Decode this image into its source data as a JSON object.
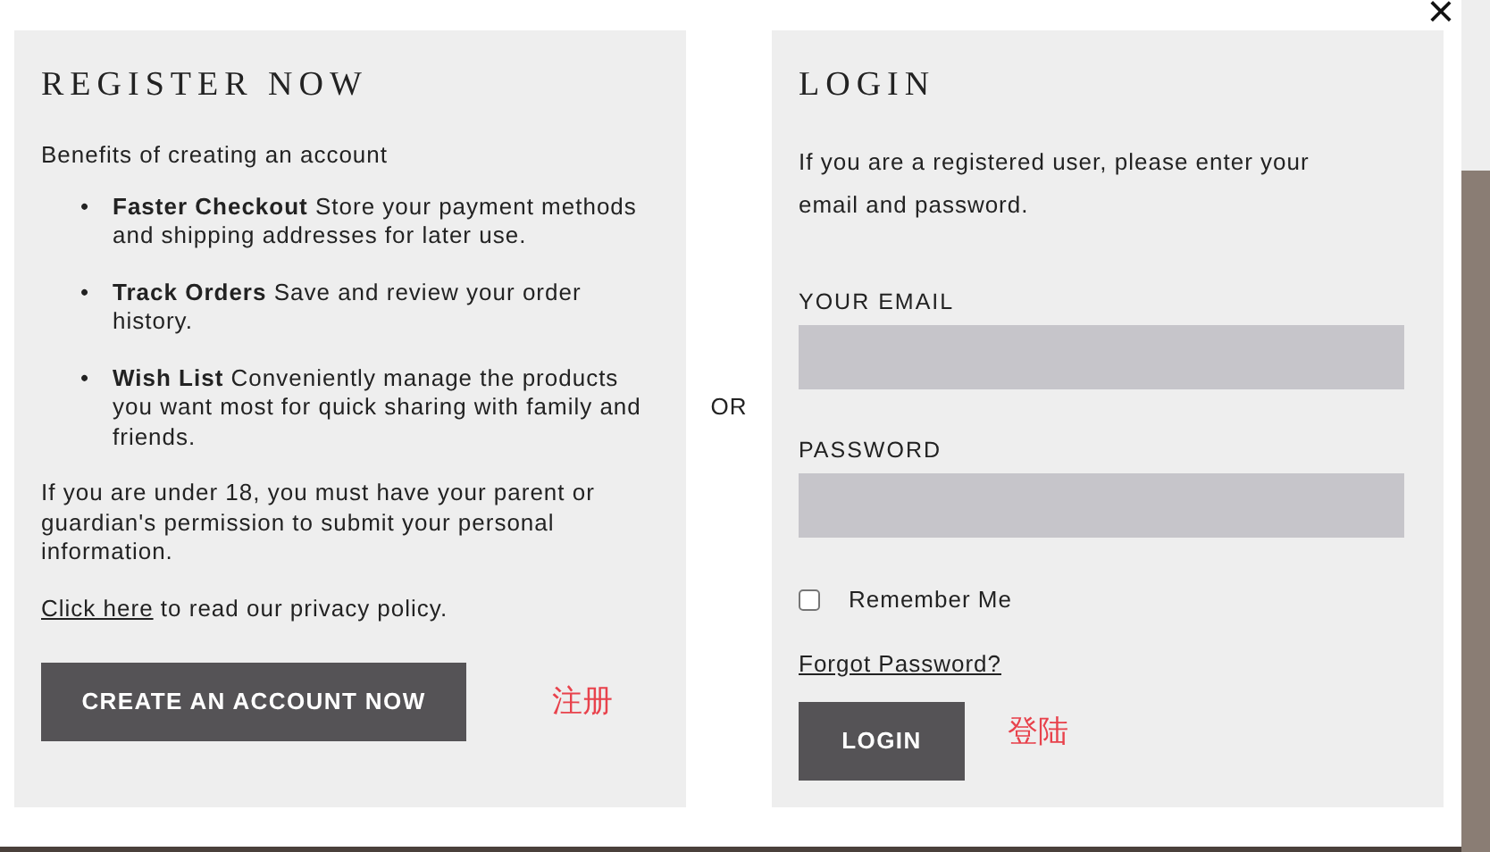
{
  "close": "×",
  "register": {
    "title": "REGISTER NOW",
    "intro": "Benefits of creating an account",
    "benefits": [
      {
        "bullet": "•",
        "text": "**Faster Checkout** Store your payment methods and shipping addresses for later use."
      },
      {
        "bullet": "•",
        "text": "**Track Orders** Save and review your order history."
      },
      {
        "bullet": "•",
        "text": "**Wish List** Conveniently manage the products you want most for quick sharing with family and friends."
      }
    ],
    "notice": "If you are under 18, you must have your parent or guardian's permission to submit your personal information.",
    "privacy": {
      "link": "Click here",
      "text": "to read our privacy policy."
    },
    "button": "CREATE AN ACCOUNT NOW",
    "annotation": "注册"
  },
  "divider": "OR",
  "login": {
    "title": "LOGIN",
    "intro": "If you are a registered user, please enter your email and password.",
    "fields": [
      {
        "label": "YOUR EMAIL"
      },
      {
        "label": "PASSWORD"
      }
    ],
    "remember": {
      "label": "Remember Me",
      "checked": false
    },
    "forgot": "Forgot Password?",
    "button": "LOGIN",
    "annotation": "登陆"
  }
}
